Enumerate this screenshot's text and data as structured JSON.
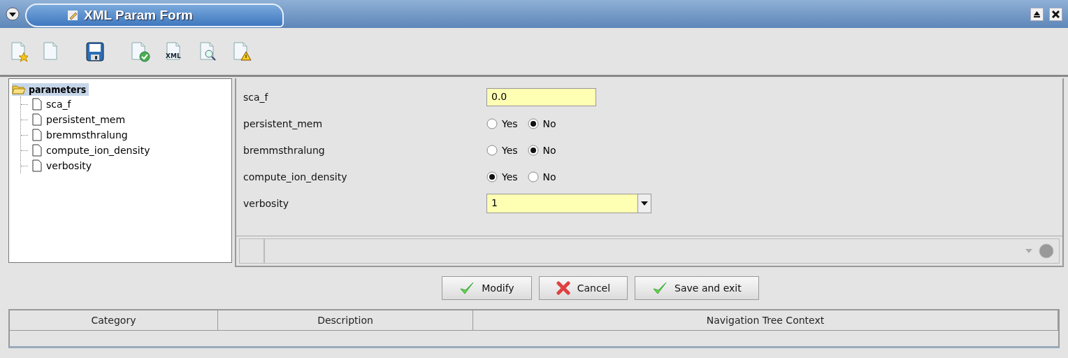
{
  "window": {
    "title": "XML Param Form"
  },
  "toolbar": [
    {
      "kind": "new"
    },
    {
      "kind": "blank"
    },
    {
      "kind": "save"
    },
    {
      "kind": "valid"
    },
    {
      "kind": "xml",
      "text": "XML"
    },
    {
      "kind": "search"
    },
    {
      "kind": "warning"
    }
  ],
  "tree": {
    "label": "parameters",
    "selected": true,
    "expanded": true,
    "children": [
      {
        "label": "sca_f"
      },
      {
        "label": "persistent_mem"
      },
      {
        "label": "bremmsthralung"
      },
      {
        "label": "compute_ion_density"
      },
      {
        "label": "verbosity"
      }
    ]
  },
  "form": {
    "fields": [
      {
        "kind": "text",
        "label": "sca_f",
        "value": "0.0"
      },
      {
        "kind": "radio",
        "label": "persistent_mem",
        "options": [
          {
            "label": "Yes",
            "selected": false
          },
          {
            "label": "No",
            "selected": true
          }
        ]
      },
      {
        "kind": "radio",
        "label": "bremmsthralung",
        "options": [
          {
            "label": "Yes",
            "selected": false
          },
          {
            "label": "No",
            "selected": true
          }
        ]
      },
      {
        "kind": "radio",
        "label": "compute_ion_density",
        "options": [
          {
            "label": "Yes",
            "selected": true
          },
          {
            "label": "No",
            "selected": false
          }
        ]
      },
      {
        "kind": "dropdown",
        "label": "verbosity",
        "value": "1"
      }
    ]
  },
  "buttons": [
    {
      "kind": "ok",
      "label": "Modify"
    },
    {
      "kind": "cancel",
      "label": "Cancel"
    },
    {
      "kind": "ok",
      "label": "Save and exit"
    }
  ],
  "table": {
    "columns": [
      "Category",
      "Description",
      "Navigation Tree Context"
    ]
  }
}
